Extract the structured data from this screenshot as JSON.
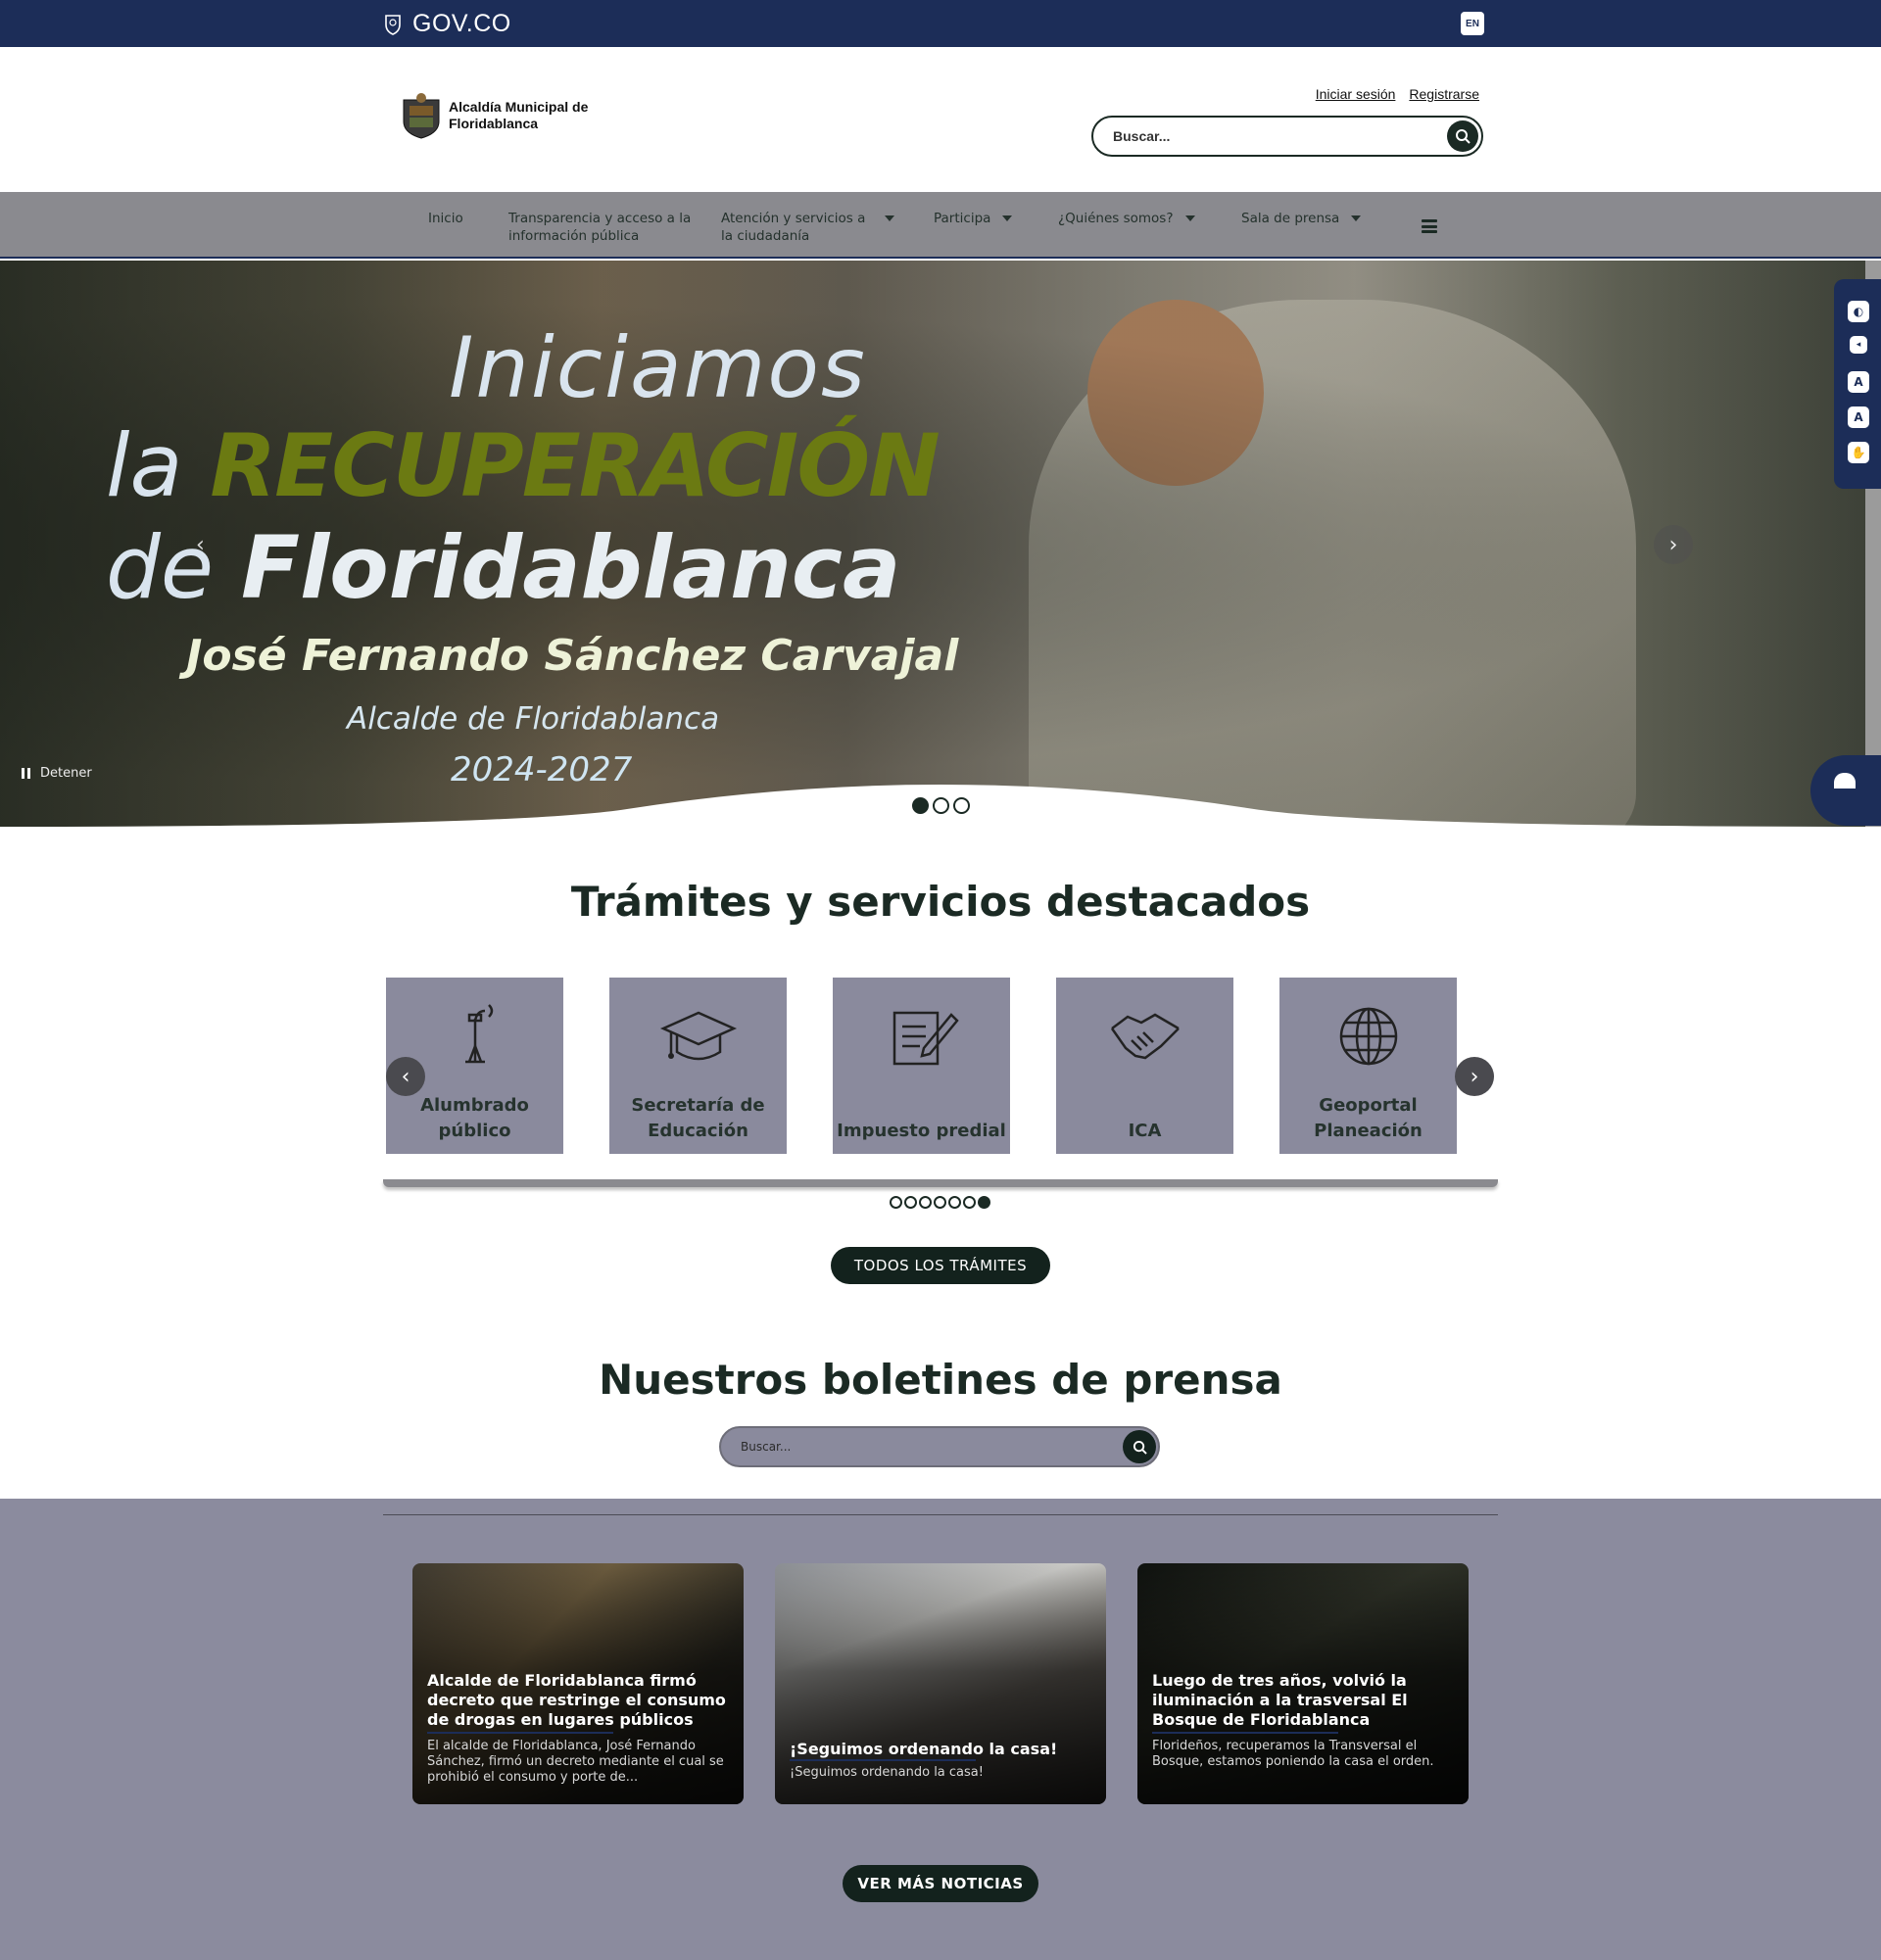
{
  "govbar": {
    "logo_text": "GOV.CO",
    "lang": "EN"
  },
  "header": {
    "brand": "Alcaldía Municipal de Floridablanca",
    "login": "Iniciar sesión",
    "register": "Registrarse",
    "search_placeholder": "Buscar..."
  },
  "nav": {
    "items": [
      {
        "label": "Inicio"
      },
      {
        "label": "Transparencia y acceso a la información pública"
      },
      {
        "label": "Atención y servicios a la ciudadanía"
      },
      {
        "label": "Participa"
      },
      {
        "label": "¿Quiénes somos?"
      },
      {
        "label": "Sala de prensa"
      }
    ]
  },
  "hero": {
    "line1": "Iniciamos",
    "line2_a": "la ",
    "line2_b": "RECUPERACIÓN",
    "line3_a": "de ",
    "line3_b": "Floridablanca",
    "name": "José Fernando Sánchez Carvajal",
    "role": "Alcalde de Floridablanca",
    "years": "2024-2027",
    "pause_label": "Detener",
    "slide_count": 3,
    "active_slide": 1
  },
  "tramites": {
    "title": "Trámites y servicios destacados",
    "cards": [
      {
        "label": "Alumbrado público",
        "icon": "streetlight-icon"
      },
      {
        "label": "Secretaría de Educación",
        "icon": "graduation-cap-icon"
      },
      {
        "label": "Impuesto predial",
        "icon": "document-pen-icon"
      },
      {
        "label": "ICA",
        "icon": "handshake-icon"
      },
      {
        "label": "Geoportal Planeación",
        "icon": "globe-icon"
      }
    ],
    "page_count": 7,
    "active_page": 7,
    "all_button": "TODOS LOS TRÁMITES"
  },
  "prensa": {
    "title": "Nuestros boletines de prensa",
    "search_placeholder": "Buscar...",
    "news": [
      {
        "title": "Alcalde de Floridablanca firmó decreto que restringe el consumo de drogas en lugares públicos",
        "summary": "El alcalde de Floridablanca, José Fernando Sánchez, firmó un decreto mediante el cual se prohibió el consumo y porte de..."
      },
      {
        "title": "¡Seguimos ordenando la casa!",
        "summary": "¡Seguimos ordenando la casa!"
      },
      {
        "title": "Luego de tres años, volvió la iluminación a la trasversal El Bosque de Floridablanca",
        "summary": "Florideños, recuperamos la Transversal el Bosque, estamos poniendo la casa el orden."
      }
    ],
    "more_button": "VER MÁS NOTICIAS"
  },
  "colors": {
    "govbar": "#1c2d58",
    "nav": "#8a8a8f",
    "card": "#8a8a9d",
    "dark_button": "#13221d",
    "title_green": "#6b7a12"
  }
}
